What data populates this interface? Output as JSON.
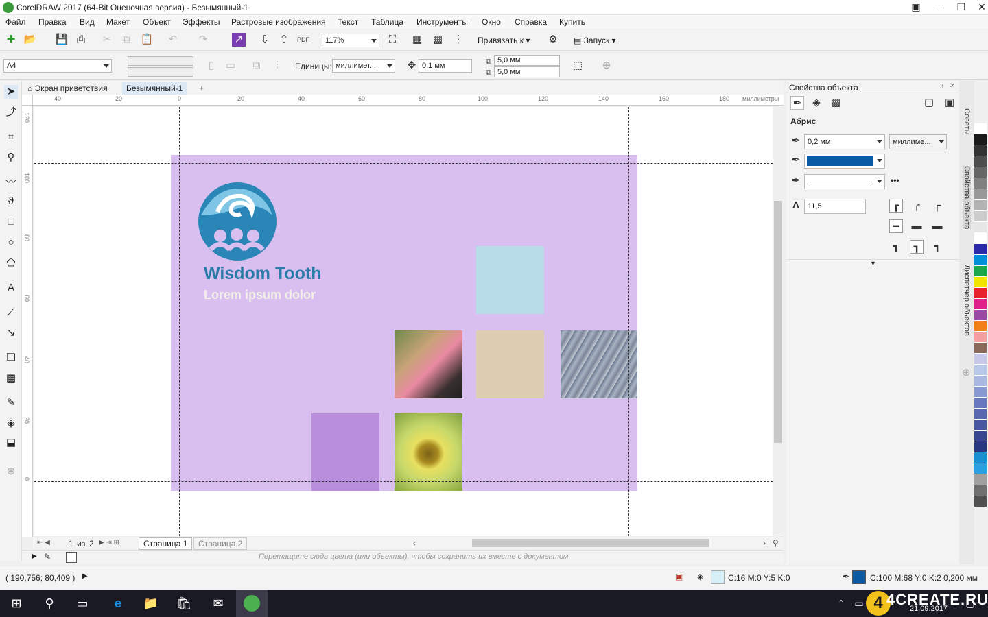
{
  "window": {
    "title": "CorelDRAW 2017 (64-Bit Оценочная версия) - Безымянный-1"
  },
  "menu": [
    "Файл",
    "Правка",
    "Вид",
    "Макет",
    "Объект",
    "Эффекты",
    "Растровые изображения",
    "Текст",
    "Таблица",
    "Инструменты",
    "Окно",
    "Справка",
    "Купить"
  ],
  "toolbar": {
    "zoom": "117%",
    "snap_label": "Привязать к",
    "launch_label": "Запуск"
  },
  "propbar": {
    "page_size": "A4",
    "units_label": "Единицы:",
    "units_value": "миллимет...",
    "nudge": "0,1 мм",
    "dup_x": "5,0 мм",
    "dup_y": "5,0 мм"
  },
  "doc_tabs": {
    "welcome": "Экран приветствия",
    "active": "Безымянный-1"
  },
  "ruler": {
    "top_labels": [
      "40",
      "20",
      "0",
      "20",
      "40",
      "60",
      "80",
      "100",
      "120",
      "140",
      "160",
      "180"
    ],
    "unit": "миллиметры",
    "left_labels": [
      "120",
      "100",
      "80",
      "60",
      "40",
      "20",
      "0"
    ]
  },
  "design": {
    "company": "Wisdom Tooth",
    "tagline": "Lorem ipsum dolor"
  },
  "pages": {
    "current": "1",
    "of_label": "из",
    "total": "2",
    "page1": "Страница 1",
    "page2": "Страница 2"
  },
  "docpalette_hint": "Перетащите сюда цвета (или объекты), чтобы сохранить их вместе с документом",
  "status": {
    "coords": "( 190,756; 80,409 )",
    "fill_info": "C:16 M:0 Y:5 K:0",
    "outline_info": "C:100 M:68 Y:0 K:2  0,200 мм"
  },
  "panel": {
    "title": "Свойства объекта",
    "section": "Абрис",
    "width": "0,2 мм",
    "width_units": "миллиме...",
    "miter": "11,5",
    "outline_color": "#0a5aa5"
  },
  "side_tabs": [
    "Советы",
    "Свойства объекта",
    "Диспетчер объектов"
  ],
  "palette": [
    "#ffffff",
    "#1a1a1a",
    "#333333",
    "#4d4d4d",
    "#666666",
    "#808080",
    "#999999",
    "#b3b3b3",
    "#cccccc",
    "#e6e6e6",
    "#ffffff",
    "#2a2aa8",
    "#0090d8",
    "#1ca84a",
    "#f2e600",
    "#e8222a",
    "#e0208a",
    "#9a4aa2",
    "#f08018",
    "#f5a0a0",
    "#8a6a5a",
    "#c8c8e8",
    "#b8c8e8",
    "#a8b8e0",
    "#8898d0",
    "#6878c0",
    "#5868b0",
    "#4858a0",
    "#384890",
    "#283880",
    "#1a90d0",
    "#2aa0e0",
    "#a0a0a0",
    "#707070",
    "#505050"
  ],
  "watermark": {
    "brand": "4CREATE.RU",
    "date": "21.09.2017"
  }
}
